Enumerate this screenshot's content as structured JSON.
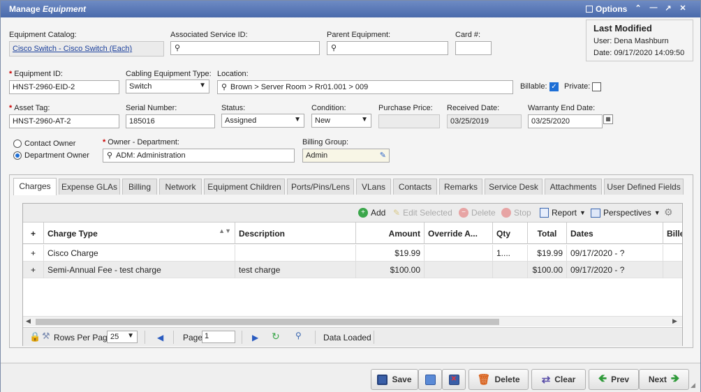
{
  "window": {
    "title_plain": "Manage ",
    "title_italic": "Equipment",
    "options_label": "Options"
  },
  "last_modified": {
    "heading": "Last Modified",
    "user": "User: Dena Mashburn",
    "date": "Date: 09/17/2020 14:09:50"
  },
  "fields": {
    "equipment_catalog": {
      "label": "Equipment Catalog:",
      "value": "Cisco Switch - Cisco Switch (Each)"
    },
    "associated_service_id": {
      "label": "Associated Service ID:",
      "value": ""
    },
    "parent_equipment": {
      "label": "Parent Equipment:",
      "value": ""
    },
    "card_number": {
      "label": "Card #:",
      "value": ""
    },
    "equipment_id": {
      "label": "Equipment ID:",
      "value": "HNST-2960-EID-2"
    },
    "cabling_equipment_type": {
      "label": "Cabling Equipment Type:",
      "value": "Switch"
    },
    "location": {
      "label": "Location:",
      "value": "Brown > Server Room > Rr01.001 > 009"
    },
    "billable": {
      "label": "Billable:",
      "checked": true
    },
    "private": {
      "label": "Private:",
      "checked": false
    },
    "asset_tag": {
      "label": "Asset Tag:",
      "value": "HNST-2960-AT-2"
    },
    "serial_number": {
      "label": "Serial Number:",
      "value": "185016"
    },
    "status": {
      "label": "Status:",
      "value": "Assigned"
    },
    "condition": {
      "label": "Condition:",
      "value": "New"
    },
    "purchase_price": {
      "label": "Purchase Price:",
      "value": ""
    },
    "received_date": {
      "label": "Received Date:",
      "value": "03/25/2019"
    },
    "warranty_end_date": {
      "label": "Warranty End Date:",
      "value": "03/25/2020"
    },
    "owner_type": {
      "options": [
        "Contact Owner",
        "Department Owner"
      ],
      "selected": "Department Owner"
    },
    "owner_department": {
      "label": "Owner - Department:",
      "value": "ADM: Administration"
    },
    "billing_group": {
      "label": "Billing Group:",
      "value": "Admin"
    }
  },
  "tabs": [
    "Charges",
    "Expense GLAs",
    "Billing",
    "Network",
    "Equipment Children",
    "Ports/Pins/Lens",
    "VLans",
    "Contacts",
    "Remarks",
    "Service Desk",
    "Attachments",
    "User Defined Fields"
  ],
  "active_tab": "Charges",
  "grid_toolbar": {
    "add": "Add",
    "edit": "Edit Selected",
    "delete": "Delete",
    "stop": "Stop",
    "report": "Report",
    "perspectives": "Perspectives"
  },
  "grid": {
    "columns": [
      "+",
      "Charge Type",
      "Description",
      "Amount",
      "Override A...",
      "Qty",
      "Total",
      "Dates",
      "Bille"
    ],
    "rows": [
      [
        "+",
        "Cisco Charge",
        "",
        "$19.99",
        "",
        "1....",
        "$19.99",
        "09/17/2020 - ?",
        ""
      ],
      [
        "+",
        "Semi-Annual Fee - test charge",
        "test charge",
        "$100.00",
        "",
        "",
        "$100.00",
        "09/17/2020 - ?",
        ""
      ]
    ]
  },
  "pager": {
    "rows_per_page_label": "Rows Per Page:",
    "rows_per_page": "25",
    "page_label": "Page:",
    "page": "1",
    "status": "Data Loaded"
  },
  "footer": {
    "save": "Save",
    "delete": "Delete",
    "clear": "Clear",
    "prev": "Prev",
    "next": "Next"
  },
  "colors": {
    "title_bar": "#4a6aab",
    "accent": "#1e6fd6",
    "required": "#cc0000"
  }
}
